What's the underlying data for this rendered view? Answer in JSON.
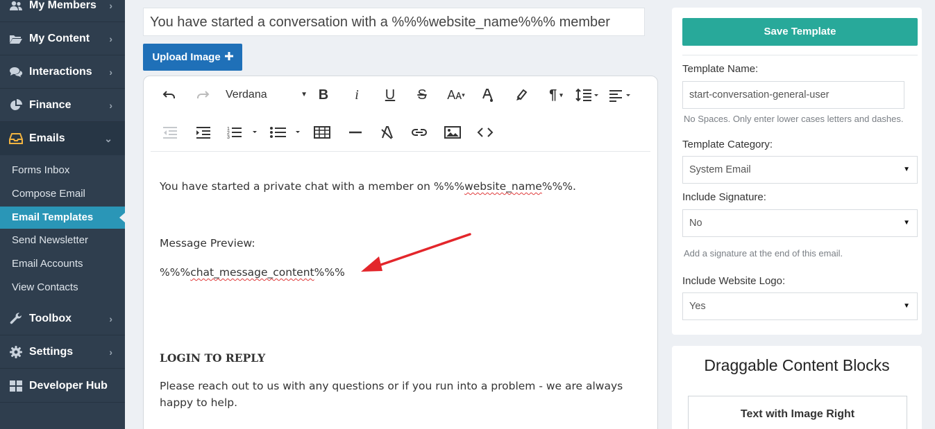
{
  "sidebar": {
    "items": [
      {
        "label": "My Members",
        "icon": "users-icon"
      },
      {
        "label": "My Content",
        "icon": "folder-open-icon"
      },
      {
        "label": "Interactions",
        "icon": "chat-bubbles-icon"
      },
      {
        "label": "Finance",
        "icon": "pie-chart-icon"
      },
      {
        "label": "Emails",
        "icon": "inbox-icon"
      },
      {
        "label": "Toolbox",
        "icon": "wrench-icon"
      },
      {
        "label": "Settings",
        "icon": "gear-icon"
      },
      {
        "label": "Developer Hub",
        "icon": "grid-icon"
      }
    ],
    "email_submenu": [
      "Forms Inbox",
      "Compose Email",
      "Email Templates",
      "Send Newsletter",
      "Email Accounts",
      "View Contacts"
    ],
    "selected_submenu": "Email Templates"
  },
  "subject": {
    "value": "You have started a conversation with a %%%website_name%%% member"
  },
  "upload": {
    "label": "Upload Image",
    "icon": "plus-icon"
  },
  "toolbar": {
    "font": "Verdana"
  },
  "editor": {
    "line1_prefix": "You have started a private chat with a member on %%%",
    "line1_var": "website_name",
    "line1_suffix": "%%%.",
    "preview_label": "Message Preview:",
    "line3_prefix": "%%%",
    "line3_var": "chat_message_content",
    "line3_suffix": "%%%",
    "login_heading": "LOGIN TO REPLY",
    "help_line1": "Please reach out to us with any questions or if you run into a problem - we are always",
    "help_line2": "happy to help."
  },
  "panel": {
    "save_label": "Save Template",
    "template_name_label": "Template Name:",
    "template_name_value": "start-conversation-general-user",
    "template_name_help": "No Spaces. Only enter lower cases letters and dashes.",
    "category_label": "Template Category:",
    "category_value": "System Email",
    "signature_label": "Include Signature:",
    "signature_value": "No",
    "signature_help": "Add a signature at the end of this email.",
    "logo_label": "Include Website Logo:",
    "logo_value": "Yes"
  },
  "blocks": {
    "title": "Draggable Content Blocks",
    "first_block": "Text with Image Right"
  },
  "colors": {
    "sidebar_bg": "#2f3e4e",
    "selected_submenu": "#2a96b7",
    "upload_button": "#1f70b8",
    "save_button": "#28a99a",
    "annotation_arrow": "#e3262b"
  }
}
